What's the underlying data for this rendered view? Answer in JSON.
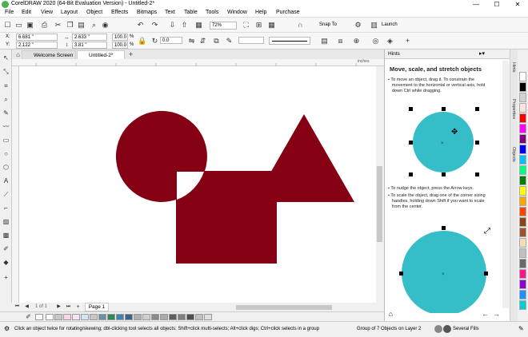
{
  "window": {
    "title": "CorelDRAW 2020 (64-Bit Evaluation Version) - Untitled-2*",
    "min": "—",
    "max": "☐",
    "close": "✕"
  },
  "menu": [
    "File",
    "Edit",
    "View",
    "Layout",
    "Object",
    "Effects",
    "Bitmaps",
    "Text",
    "Table",
    "Tools",
    "Window",
    "Help",
    "Purchase"
  ],
  "toolbar": {
    "zoom": "72%",
    "snap_to": "Snap To",
    "launch": "Launch"
  },
  "propbar": {
    "x": "6.681 \"",
    "y": "2.122 \"",
    "w": "2.633 \"",
    "h": "3.81 \"",
    "sx": "100.0",
    "sy": "100.0",
    "sx_unit": "%",
    "sy_unit": "%",
    "angle": "0.0",
    "x_label": "X:",
    "y_label": "Y:",
    "width_label": "\"\"",
    "rotate_icon": "↻"
  },
  "tabs": {
    "welcome": "Welcome Screen",
    "doc": "Untitled-2*"
  },
  "ruler": {
    "unit": "inches"
  },
  "pages": {
    "counter": "1 of 1",
    "page_tab": "Page 1"
  },
  "palette_colors": [
    "#ffffff",
    "#000000",
    "#ffffff",
    "#c8c8c8",
    "#fcd5e5",
    "#f7e6f5",
    "#d4e6f5",
    "#c8c8c8",
    "#6d8fa8",
    "#2e8b57",
    "#4682b4",
    "#36648b",
    "#b0b0b0",
    "#d0d0d0",
    "#8b8b8b",
    "#a9a9a9",
    "#5f5f5f",
    "#808080",
    "#4f4f4f",
    "#c0c0c0",
    "#e0e0e0"
  ],
  "right_palette": [
    "#ffffff",
    "#000000",
    "#d3d3d3",
    "#ffe4e1",
    "#ff0000",
    "#ff00ff",
    "#800080",
    "#0000ff",
    "#00bfff",
    "#00ff7f",
    "#008000",
    "#ffff00",
    "#ffa500",
    "#ff4500",
    "#8b4513",
    "#a0522d",
    "#f5deb3",
    "#c0c0c0",
    "#696969",
    "#ff1493",
    "#9400d3",
    "#1e90ff",
    "#00ced1"
  ],
  "shape_color": "#850012",
  "teal": "#35bec8",
  "hints": {
    "header": "Hints",
    "title": "Move, scale, and stretch objects",
    "p1a": "• To move an object, drag it. To constrain the",
    "p1b": "movement to the horizontal or vertical axis, hold",
    "p1c": "down Ctrl while dragging.",
    "p2": "• To nudge the object, press the Arrow keys.",
    "p3a": "• To scale the object, drag one of the corner sizing",
    "p3b": "handles, holding down Shift if you want to scale",
    "p3c": "from the center."
  },
  "docker_tabs": [
    "Hints",
    "Properties",
    "Objects"
  ],
  "status": {
    "message": "Click an object twice for rotating/skewing; dbl-clicking tool selects all objects; Shift+click multi-selects; Alt+click digs; Ctrl+click selects in a group",
    "selection": "Group of 7 Objects on Layer 2",
    "fill": "Several Fills"
  }
}
